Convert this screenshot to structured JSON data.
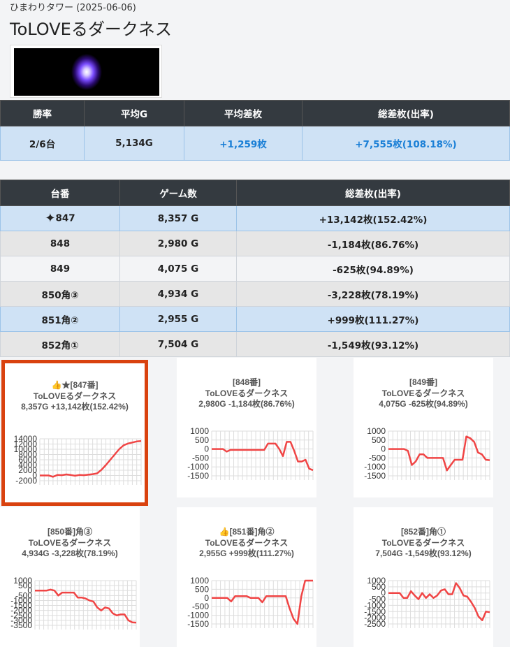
{
  "header": {
    "subtitle": "ひまわりタワー (2025-06-06)",
    "title": "ToLOVEるダークネス"
  },
  "summary": {
    "headers": [
      "勝率",
      "平均G",
      "平均差枚",
      "総差枚(出率)"
    ],
    "values": [
      "2/6台",
      "5,134G",
      "+1,259枚",
      "+7,555枚(108.18%)"
    ]
  },
  "detail": {
    "headers": [
      "台番",
      "ゲーム数",
      "総差枚(出率)"
    ],
    "rows": [
      {
        "num": "847",
        "games": "8,357 G",
        "diff": "+13,142枚(152.42%)"
      },
      {
        "num": "848",
        "games": "2,980 G",
        "diff": "-1,184枚(86.76%)"
      },
      {
        "num": "849",
        "games": "4,075 G",
        "diff": "-625枚(94.89%)"
      },
      {
        "num": "850角③",
        "games": "4,934 G",
        "diff": "-3,228枚(78.19%)"
      },
      {
        "num": "851角②",
        "games": "2,955 G",
        "diff": "+999枚(111.27%)"
      },
      {
        "num": "852角①",
        "games": "7,504 G",
        "diff": "-1,549枚(93.12%)"
      }
    ]
  },
  "colors": {
    "accent_blue": "#1a7fd6",
    "line_red": "#f04545",
    "selected_border": "#d9420f",
    "table_head": "#343a40"
  },
  "cards": [
    {
      "title": "👍★[847番]",
      "name": "ToLOVEるダークネス",
      "stats": "8,357G +13,142枚(152.42%)"
    },
    {
      "title": "[848番]",
      "name": "ToLOVEるダークネス",
      "stats": "2,980G -1,184枚(86.76%)"
    },
    {
      "title": "[849番]",
      "name": "ToLOVEるダークネス",
      "stats": "4,075G -625枚(94.89%)"
    },
    {
      "title": "[850番]角③",
      "name": "ToLOVEるダークネス",
      "stats": "4,934G -3,228枚(78.19%)"
    },
    {
      "title": "👍[851番]角②",
      "name": "ToLOVEるダークネス",
      "stats": "2,955G +999枚(111.27%)"
    },
    {
      "title": "[852番]角①",
      "name": "ToLOVEるダークネス",
      "stats": "7,504G -1,549枚(93.12%)"
    }
  ],
  "chart_data": [
    {
      "type": "line",
      "ticks": [
        "14000",
        "12000",
        "10000",
        "8000",
        "6000",
        "4000",
        "2000",
        "0",
        "-2000"
      ],
      "ylim": [
        -2000,
        14000
      ],
      "values": [
        0,
        0,
        0,
        -500,
        200,
        100,
        400,
        200,
        -100,
        200,
        100,
        300,
        500,
        800,
        2200,
        4000,
        6000,
        8000,
        10000,
        11500,
        12200,
        12600,
        13000,
        13142
      ]
    },
    {
      "type": "line",
      "ticks": [
        "1000",
        "500",
        "0",
        "-500",
        "-1000",
        "-1500"
      ],
      "ylim": [
        -1500,
        1000
      ],
      "values": [
        0,
        0,
        0,
        0,
        -150,
        -50,
        -50,
        -50,
        -50,
        -50,
        -50,
        -50,
        -50,
        -50,
        -50,
        300,
        300,
        300,
        0,
        -400,
        400,
        400,
        -100,
        -700,
        -700,
        -600,
        -1100,
        -1184
      ]
    },
    {
      "type": "line",
      "ticks": [
        "1000",
        "500",
        "0",
        "-500",
        "-1000",
        "-1500"
      ],
      "ylim": [
        -1500,
        1000
      ],
      "values": [
        0,
        0,
        0,
        0,
        0,
        -100,
        -900,
        -700,
        -300,
        -300,
        -500,
        -500,
        -500,
        -500,
        -500,
        -1200,
        -900,
        -600,
        -600,
        -600,
        700,
        600,
        400,
        -200,
        -300,
        -600,
        -625
      ]
    },
    {
      "type": "line",
      "ticks": [
        "1000",
        "500",
        "0",
        "-500",
        "-1000",
        "-1500",
        "-2000",
        "-2500",
        "-3000",
        "-3500"
      ],
      "ylim": [
        -3500,
        1000
      ],
      "values": [
        0,
        0,
        0,
        0,
        100,
        0,
        -500,
        -200,
        -200,
        -200,
        -200,
        -700,
        -700,
        -800,
        -1000,
        -1100,
        -1700,
        -2000,
        -1700,
        -1800,
        -2300,
        -2500,
        -2400,
        -2400,
        -3000,
        -3200,
        -3228
      ]
    },
    {
      "type": "line",
      "ticks": [
        "1000",
        "500",
        "0",
        "-500",
        "-1000",
        "-1500"
      ],
      "ylim": [
        -1500,
        1000
      ],
      "values": [
        0,
        0,
        0,
        0,
        0,
        -200,
        100,
        100,
        100,
        100,
        0,
        0,
        0,
        -250,
        100,
        100,
        100,
        100,
        100,
        100,
        -600,
        -1200,
        -1500,
        100,
        999,
        999,
        999
      ]
    },
    {
      "type": "line",
      "ticks": [
        "1000",
        "500",
        "0",
        "-500",
        "-1000",
        "-1500",
        "-2000",
        "-2500"
      ],
      "ylim": [
        -2500,
        1000
      ],
      "values": [
        0,
        0,
        0,
        0,
        -400,
        -400,
        150,
        -200,
        -500,
        0,
        -400,
        -100,
        -400,
        -200,
        200,
        300,
        -100,
        -100,
        800,
        400,
        -200,
        -300,
        -700,
        -1200,
        -1900,
        -2200,
        -1500,
        -1549
      ]
    }
  ]
}
